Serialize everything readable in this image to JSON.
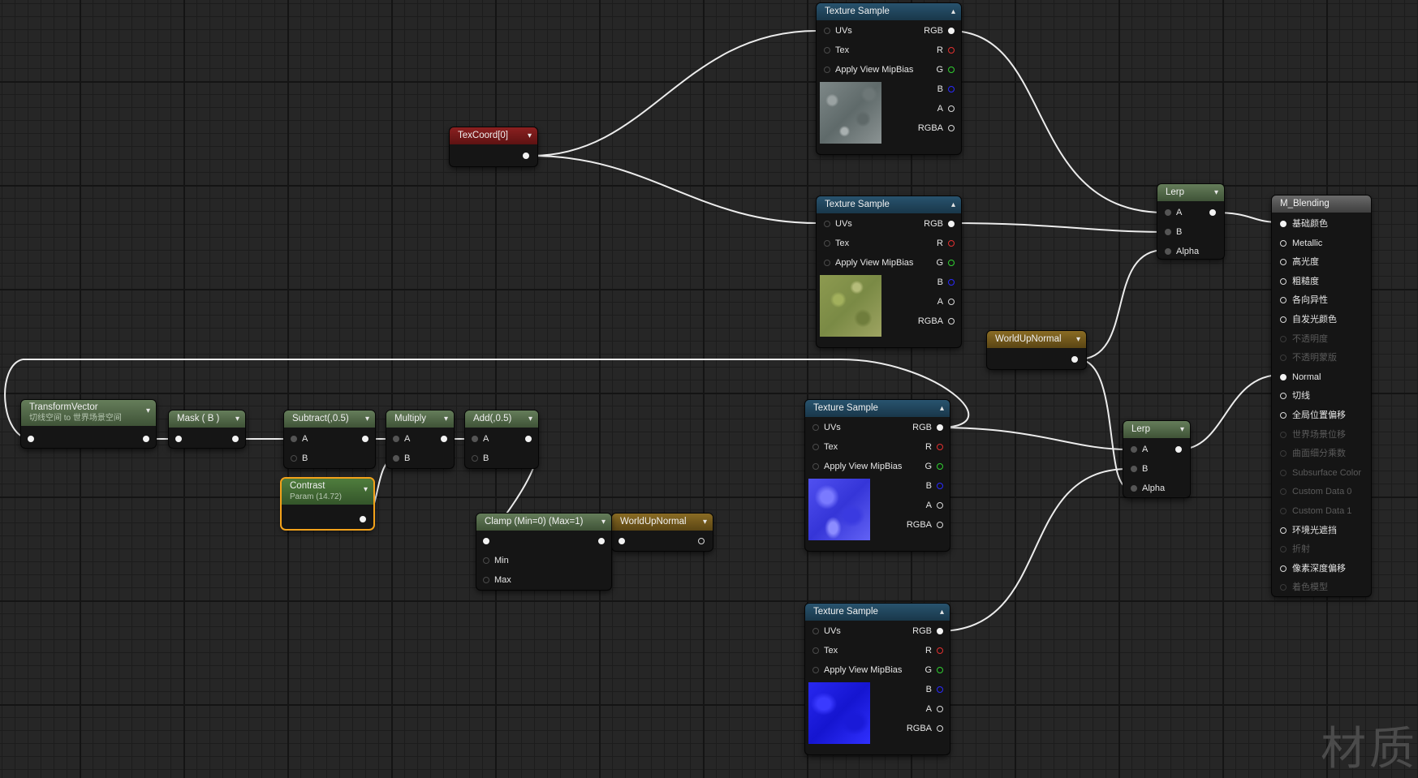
{
  "nodes": {
    "tex1": {
      "title": "Texture Sample",
      "uvs": "UVs",
      "tex": "Tex",
      "mip": "Apply View MipBias",
      "rgb": "RGB",
      "r": "R",
      "g": "G",
      "b": "B",
      "a": "A",
      "rgba": "RGBA"
    },
    "tex2": {
      "title": "Texture Sample",
      "uvs": "UVs",
      "tex": "Tex",
      "mip": "Apply View MipBias",
      "rgb": "RGB",
      "r": "R",
      "g": "G",
      "b": "B",
      "a": "A",
      "rgba": "RGBA"
    },
    "tex3": {
      "title": "Texture Sample",
      "uvs": "UVs",
      "tex": "Tex",
      "mip": "Apply View MipBias",
      "rgb": "RGB",
      "r": "R",
      "g": "G",
      "b": "B",
      "a": "A",
      "rgba": "RGBA"
    },
    "tex4": {
      "title": "Texture Sample",
      "uvs": "UVs",
      "tex": "Tex",
      "mip": "Apply View MipBias",
      "rgb": "RGB",
      "r": "R",
      "g": "G",
      "b": "B",
      "a": "A",
      "rgba": "RGBA"
    },
    "texcoord": {
      "title": "TexCoord[0]"
    },
    "lerp1": {
      "title": "Lerp",
      "a": "A",
      "b": "B",
      "alpha": "Alpha"
    },
    "lerp2": {
      "title": "Lerp",
      "a": "A",
      "b": "B",
      "alpha": "Alpha"
    },
    "worldup1": {
      "title": "WorldUpNormal"
    },
    "worldup2": {
      "title": "WorldUpNormal"
    },
    "transform": {
      "title": "TransformVector",
      "subtitle": "切线空间 to 世界场景空间"
    },
    "mask": {
      "title": "Mask ( B )"
    },
    "subtract": {
      "title": "Subtract(,0.5)",
      "a": "A",
      "b": "B"
    },
    "multiply": {
      "title": "Multiply",
      "a": "A",
      "b": "B"
    },
    "add": {
      "title": "Add(,0.5)",
      "a": "A",
      "b": "B"
    },
    "contrast": {
      "title": "Contrast",
      "subtitle": "Param (14.72)"
    },
    "clamp": {
      "title": "Clamp (Min=0) (Max=1)",
      "min": "Min",
      "max": "Max"
    },
    "material": {
      "title": "M_Blending",
      "inputs": [
        {
          "label": "基础颜色",
          "state": "connected"
        },
        {
          "label": "Metallic",
          "state": "active"
        },
        {
          "label": "高光度",
          "state": "active"
        },
        {
          "label": "粗糙度",
          "state": "active"
        },
        {
          "label": "各向异性",
          "state": "active"
        },
        {
          "label": "自发光颜色",
          "state": "active"
        },
        {
          "label": "不透明度",
          "state": "disabled"
        },
        {
          "label": "不透明蒙版",
          "state": "disabled"
        },
        {
          "label": "Normal",
          "state": "connected"
        },
        {
          "label": "切线",
          "state": "active"
        },
        {
          "label": "全局位置偏移",
          "state": "active"
        },
        {
          "label": "世界场景位移",
          "state": "disabled"
        },
        {
          "label": "曲面细分乘数",
          "state": "disabled"
        },
        {
          "label": "Subsurface Color",
          "state": "disabled"
        },
        {
          "label": "Custom Data 0",
          "state": "disabled"
        },
        {
          "label": "Custom Data 1",
          "state": "disabled"
        },
        {
          "label": "环境光遮挡",
          "state": "active"
        },
        {
          "label": "折射",
          "state": "disabled"
        },
        {
          "label": "像素深度偏移",
          "state": "active"
        },
        {
          "label": "着色模型",
          "state": "disabled"
        }
      ]
    }
  },
  "watermark": "材质",
  "colors": {
    "wire": "#ececec",
    "selected": "#f3a21a",
    "texHeader": "#28536e",
    "mathHeader": "#657d5a",
    "texcoordHeader": "#8b2020",
    "worldUpHeader": "#8a6c24"
  }
}
